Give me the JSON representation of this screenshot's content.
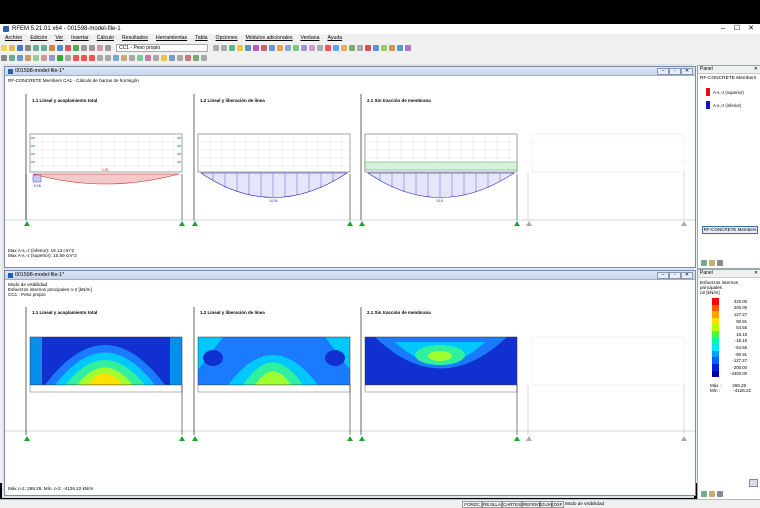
{
  "titlebar": {
    "title": "RFEM 5.21.01 x64 - 001598-model-file-1"
  },
  "menu": [
    "Archivo",
    "Edición",
    "Ver",
    "Insertar",
    "Cálculo",
    "Resultados",
    "Herramientas",
    "Tabla",
    "Opciones",
    "Módulos adicionales",
    "Ventana",
    "Ayuda"
  ],
  "toolbar": {
    "loadcase": "CC1 - Peso propio"
  },
  "win1": {
    "title": "001598-model-file-1*",
    "subtitle": "RF-CONCRETE Members CA1 - Cálculo de barras de hormigón",
    "panels": [
      "1.1 Lineal y acoplamiento total",
      "1.2 Lineal y liberación de línea",
      "2.1 Sin tracción de membrana"
    ],
    "values": [
      "1.81",
      "5.26",
      "10.00",
      "10.5"
    ],
    "max1": "Max A-s,-z (inferior): 19.13 cm^2",
    "max2": "Max A-s,-z (superior): 10.59 cm^2"
  },
  "win2": {
    "title": "001598-model-file-1*",
    "line1": "Modo de visibilidad",
    "line2": "Esfuerzos internos principales n-2 [kN/m]",
    "line3": "CC1 : Peso propio",
    "panels": [
      "1.1 Lineal y acoplamiento total",
      "1.2 Lineal y liberación de línea",
      "2.1 Sin tracción de membrana"
    ],
    "footer": "Máx n-2: 269.29, Mín. n-2: -4126.22 kN/m"
  },
  "panel1": {
    "header": "Panel",
    "title": "RF-CONCRETE Members",
    "legend": [
      {
        "label": "A-s,-z (superior)",
        "color": "#e01010"
      },
      {
        "label": "A-s,-z (inferior)",
        "color": "#1010d0"
      }
    ],
    "button": "RF-CONCRETE Members"
  },
  "panel2": {
    "header": "Panel",
    "title": "Esfuerzos internos principales",
    "unit": "n2 [kN/m]",
    "scale": [
      {
        "v": "320.00",
        "c": "#ff0000"
      },
      {
        "v": "200.00",
        "c": "#ff5a00"
      },
      {
        "v": "127.27",
        "c": "#ffa000"
      },
      {
        "v": "90.91",
        "c": "#ffe000"
      },
      {
        "v": "54.55",
        "c": "#b4ff00"
      },
      {
        "v": "18.18",
        "c": "#40ff40"
      },
      {
        "v": "-18.18",
        "c": "#00ff9c"
      },
      {
        "v": "-54.55",
        "c": "#00e8ff"
      },
      {
        "v": "-90.91",
        "c": "#00a0ff"
      },
      {
        "v": "-127.27",
        "c": "#0060ff"
      },
      {
        "v": "-200.00",
        "c": "#0020e0"
      },
      {
        "v": "-4400.00",
        "c": "#0000a0"
      }
    ],
    "max_label": "Máx :",
    "max_value": "269.29",
    "min_label": "Mín :",
    "min_value": "-4126.22"
  },
  "statusbar": {
    "items": [
      "FORZC",
      "REJILLA",
      "CARTES",
      "REFENT",
      "GUIA",
      "DXF"
    ],
    "text": "Modo de visibilidad"
  }
}
